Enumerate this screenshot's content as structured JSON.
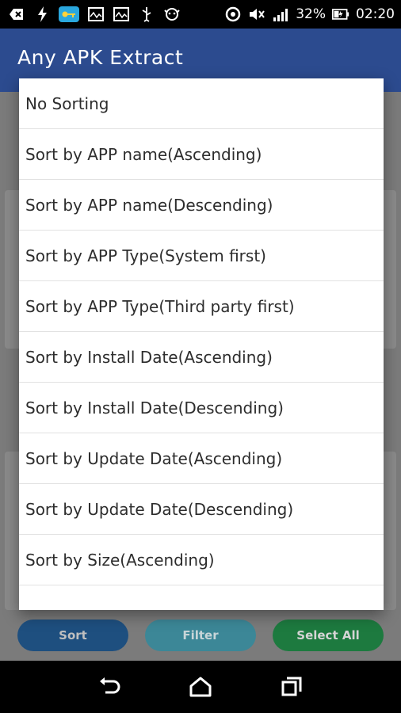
{
  "status_bar": {
    "battery_percent": "32%",
    "time": "02:20",
    "left_icons": [
      "back-icon",
      "lightning-icon",
      "key-icon",
      "chart-icon",
      "chart-icon-2",
      "usb-icon",
      "dog-icon"
    ],
    "right_icons": [
      "circle-icon",
      "mute-icon",
      "signal-icon",
      "battery-icon"
    ]
  },
  "app_bar": {
    "title": "Any APK Extract"
  },
  "sort_dialog": {
    "options": [
      "No Sorting",
      "Sort by APP name(Ascending)",
      "Sort by APP name(Descending)",
      "Sort by APP Type(System first)",
      "Sort by APP Type(Third party first)",
      "Sort by Install Date(Ascending)",
      "Sort by Install Date(Descending)",
      "Sort by Update Date(Ascending)",
      "Sort by Update Date(Descending)",
      "Sort by Size(Ascending)"
    ]
  },
  "bottom_actions": {
    "sort_label": "Sort",
    "filter_label": "Filter",
    "select_all_label": "Select All"
  },
  "colors": {
    "app_bar": "#2c4b8f",
    "sort_button": "#1e4f7f",
    "filter_button": "#3c8797",
    "select_all_button": "#1d7a3f"
  },
  "nav_bar": {
    "icons": [
      "back-nav-icon",
      "home-nav-icon",
      "recents-nav-icon"
    ]
  }
}
